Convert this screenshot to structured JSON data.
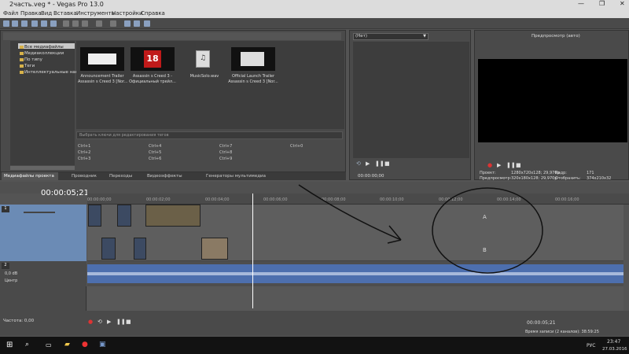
{
  "window": {
    "title": "2часть.veg * - Vegas Pro 13.0",
    "minimize": "—",
    "maximize": "❐",
    "close": "✕"
  },
  "menu": [
    "Файл",
    "Правка",
    "Вид",
    "Вставка",
    "Инструменты",
    "Настройки",
    "Справка"
  ],
  "explorer": {
    "tree": [
      "Все медиафайлы",
      "Медиаколлекции",
      "По типу",
      "Теги",
      "Интеллектуальные нак"
    ],
    "media": [
      {
        "thumb_text": "",
        "label": "Announcement Trailer",
        "label2": "Assassin s Creed 3 [Nor..."
      },
      {
        "thumb_text": "18",
        "label": "Assassin s Creed 3 -",
        "label2": "Официальный трейл..."
      },
      {
        "thumb_text": "",
        "label": "MusicSolo.wav",
        "label2": ""
      },
      {
        "thumb_text": "",
        "label": "Official Launch Trailer",
        "label2": "Assassin s Creed 3 [Nor..."
      }
    ],
    "tags_placeholder": "Выбрать ключи для редактирования тегов",
    "shortcuts": [
      "Ctrl+1",
      "Ctrl+2",
      "Ctrl+3",
      "Ctrl+4",
      "Ctrl+5",
      "Ctrl+6",
      "Ctrl+7",
      "Ctrl+8",
      "Ctrl+9",
      "Ctrl+0"
    ]
  },
  "tabs": [
    "Медиафайлы проекта",
    "Проводник",
    "Переходы",
    "Видеоэффекты",
    "Генераторы мультимедиа"
  ],
  "trimmer": {
    "dropdown": "(Нет)",
    "timecode": "00:00:00;00"
  },
  "preview": {
    "mode": "Предпросмотр (авто)",
    "project_label": "Проект:",
    "project_val": "1280x720x128; 29,970p",
    "preview_label": "Предпросмотр:",
    "preview_val": "320x180x128; 29,970p",
    "frame_label": "Кадр:",
    "frame_val": "171",
    "display_label": "Отобразить:",
    "display_val": "374x210x32"
  },
  "timeline": {
    "timecode": "00:00:05;21",
    "ruler": [
      "00:00:00;00",
      "00:00:02;00",
      "00:00:04;00",
      "00:00:06;00",
      "00:00:08;00",
      "00:00:10;00",
      "00:00:12;00",
      "00:00:14;00",
      "00:00:16;00"
    ],
    "track_letters": [
      "A",
      "B"
    ],
    "audio_level": "0,0 dB",
    "pan": "Центр",
    "rate": "Частота: 0,00",
    "cursor_time": "00:00:05;21",
    "record_time": "Время записи (2 каналов): 38:59:25"
  },
  "taskbar": {
    "lang": "РУС",
    "time": "23:47",
    "date": "27.03.2016"
  }
}
